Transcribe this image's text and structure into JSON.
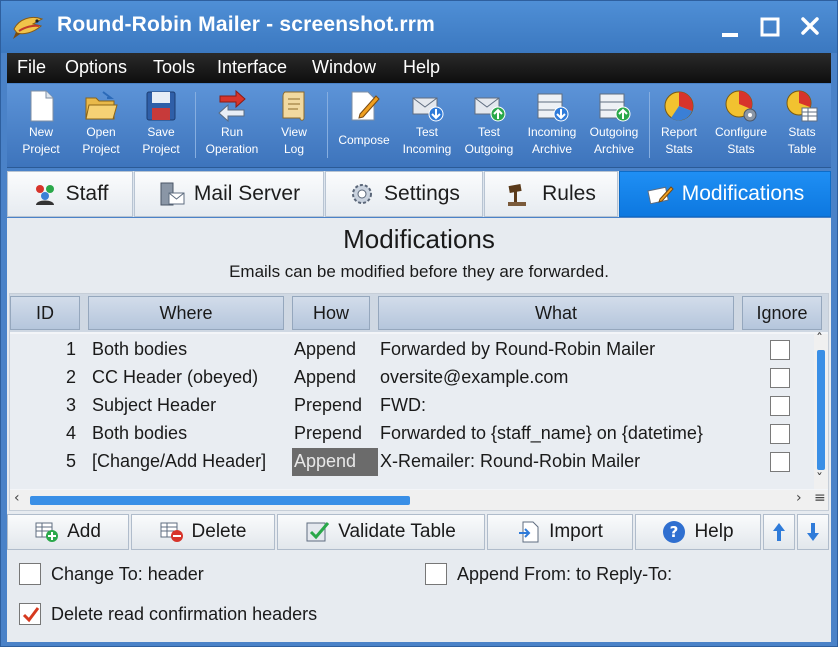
{
  "window": {
    "title": "Round-Robin Mailer - screenshot.rrm"
  },
  "menu": [
    {
      "label": "File"
    },
    {
      "label": "Options"
    },
    {
      "label": "Tools"
    },
    {
      "label": "Interface"
    },
    {
      "label": "Window"
    },
    {
      "label": "Help"
    }
  ],
  "toolbar": [
    {
      "line1": "New",
      "line2": "Project",
      "icon": "new-file-icon"
    },
    {
      "line1": "Open",
      "line2": "Project",
      "icon": "open-folder-icon"
    },
    {
      "line1": "Save",
      "line2": "Project",
      "icon": "save-disk-icon"
    },
    {
      "line1": "Run",
      "line2": "Operation",
      "icon": "run-arrows-icon"
    },
    {
      "line1": "View",
      "line2": "Log",
      "icon": "scroll-log-icon"
    },
    {
      "line1": "Compose",
      "line2": "",
      "icon": "compose-icon"
    },
    {
      "line1": "Test",
      "line2": "Incoming",
      "icon": "test-incoming-icon"
    },
    {
      "line1": "Test",
      "line2": "Outgoing",
      "icon": "test-outgoing-icon"
    },
    {
      "line1": "Incoming",
      "line2": "Archive",
      "icon": "incoming-archive-icon"
    },
    {
      "line1": "Outgoing",
      "line2": "Archive",
      "icon": "outgoing-archive-icon"
    },
    {
      "line1": "Report",
      "line2": "Stats",
      "icon": "report-pie-icon"
    },
    {
      "line1": "Configure",
      "line2": "Stats",
      "icon": "configure-pie-icon"
    },
    {
      "line1": "Stats",
      "line2": "Table",
      "icon": "stats-table-icon"
    }
  ],
  "tabs": [
    {
      "label": "Staff",
      "active": false
    },
    {
      "label": "Mail Server",
      "active": false
    },
    {
      "label": "Settings",
      "active": false
    },
    {
      "label": "Rules",
      "active": false
    },
    {
      "label": "Modifications",
      "active": true
    }
  ],
  "page": {
    "heading": "Modifications",
    "subheading": "Emails can be modified before they are forwarded."
  },
  "table": {
    "columns": [
      "ID",
      "Where",
      "How",
      "What",
      "Ignore"
    ],
    "rows": [
      {
        "id": "1",
        "where": "Both bodies",
        "how": "Append",
        "what": "Forwarded by Round-Robin Mailer",
        "ignore": false
      },
      {
        "id": "2",
        "where": "CC Header (obeyed)",
        "how": "Append",
        "what": "oversite@example.com",
        "ignore": false
      },
      {
        "id": "3",
        "where": "Subject Header",
        "how": "Prepend",
        "what": "FWD:",
        "ignore": false
      },
      {
        "id": "4",
        "where": "Both bodies",
        "how": "Prepend",
        "what": "Forwarded to {staff_name} on {datetime}",
        "ignore": false
      },
      {
        "id": "5",
        "where": "[Change/Add Header]",
        "how": "Append",
        "what": "X-Remailer: Round-Robin Mailer",
        "ignore": false
      }
    ],
    "selected_row": 4,
    "selected_column": "how"
  },
  "buttons": {
    "add": "Add",
    "delete": "Delete",
    "validate": "Validate Table",
    "import": "Import",
    "help": "Help"
  },
  "options": {
    "change_to": {
      "label": "Change To: header",
      "checked": false
    },
    "append_from": {
      "label": "Append From: to Reply-To:",
      "checked": false
    },
    "delete_read": {
      "label": "Delete read confirmation headers",
      "checked": true
    }
  },
  "colors": {
    "accent": "#0d78e0",
    "titlebar": "#3b78c0",
    "check_mark": "#d6391f"
  }
}
